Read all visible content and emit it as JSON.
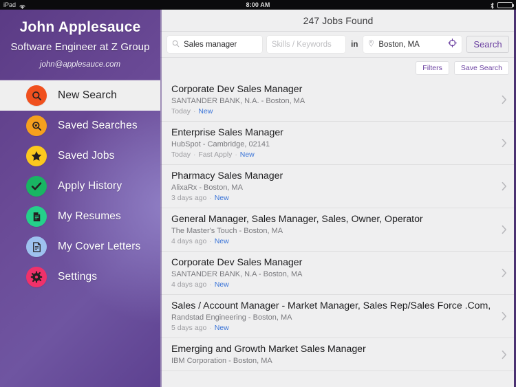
{
  "status_bar": {
    "device": "iPad",
    "wifi_icon": "wifi-icon",
    "time": "8:00 AM",
    "bluetooth_icon": "bluetooth-icon",
    "battery_icon": "battery-icon"
  },
  "sidebar": {
    "profile": {
      "name": "John Applesauce",
      "title": "Software Engineer at Z Group",
      "email": "john@applesauce.com"
    },
    "items": [
      {
        "label": "New Search",
        "icon": "search-icon",
        "color": "#f0501e",
        "active": true
      },
      {
        "label": "Saved Searches",
        "icon": "saved-search-icon",
        "color": "#f5a01e",
        "active": false
      },
      {
        "label": "Saved Jobs",
        "icon": "star-icon",
        "color": "#fbc81e",
        "active": false
      },
      {
        "label": "Apply History",
        "icon": "check-icon",
        "color": "#19b563",
        "active": false
      },
      {
        "label": "My Resumes",
        "icon": "document-icon",
        "color": "#25d08a",
        "active": false
      },
      {
        "label": "My Cover Letters",
        "icon": "letter-icon",
        "color": "#9ec2ef",
        "active": false
      },
      {
        "label": "Settings",
        "icon": "gear-icon",
        "color": "#f0316a",
        "active": false
      }
    ]
  },
  "main": {
    "header_title": "247 Jobs Found",
    "search": {
      "keyword_value": "Sales manager",
      "keyword_icon": "search-icon",
      "skills_placeholder": "Skills / Keywords",
      "in_label": "in",
      "location_value": "Boston, MA",
      "location_icon": "map-pin-icon",
      "gps_icon": "crosshair-icon",
      "search_button": "Search"
    },
    "filters": {
      "filters_label": "Filters",
      "save_search_label": "Save Search"
    },
    "jobs": [
      {
        "title": "Corporate Dev Sales Manager",
        "company": "SANTANDER BANK, N.A. - Boston, MA",
        "age": "Today",
        "tags": [
          "New"
        ]
      },
      {
        "title": "Enterprise Sales Manager",
        "company": "HubSpot - Cambridge, 02141",
        "age": "Today",
        "tags": [
          "Fast Apply",
          "New"
        ]
      },
      {
        "title": "Pharmacy Sales Manager",
        "company": "AlixaRx - Boston, MA",
        "age": "3 days ago",
        "tags": [
          "New"
        ]
      },
      {
        "title": "General Manager, Sales Manager, Sales, Owner, Operator",
        "company": "The Master's Touch - Boston, MA",
        "age": "4 days ago",
        "tags": [
          "New"
        ]
      },
      {
        "title": "Corporate Dev Sales Manager",
        "company": "SANTANDER BANK, N.A - Boston, MA",
        "age": "4 days ago",
        "tags": [
          "New"
        ]
      },
      {
        "title": "Sales / Account Manager - Market Manager, Sales Rep/Sales Force .Com,",
        "company": "Randstad Engineering - Boston, MA",
        "age": "5 days ago",
        "tags": [
          "New"
        ]
      },
      {
        "title": "Emerging and Growth Market Sales Manager",
        "company": "IBM Corporation - Boston, MA",
        "age": "",
        "tags": []
      }
    ]
  },
  "colors": {
    "brand_purple": "#6a3fa0",
    "sidebar_dark": "#5b3b85",
    "sidebar_light": "#8f7ec4",
    "new_tag": "#3a74d8"
  }
}
